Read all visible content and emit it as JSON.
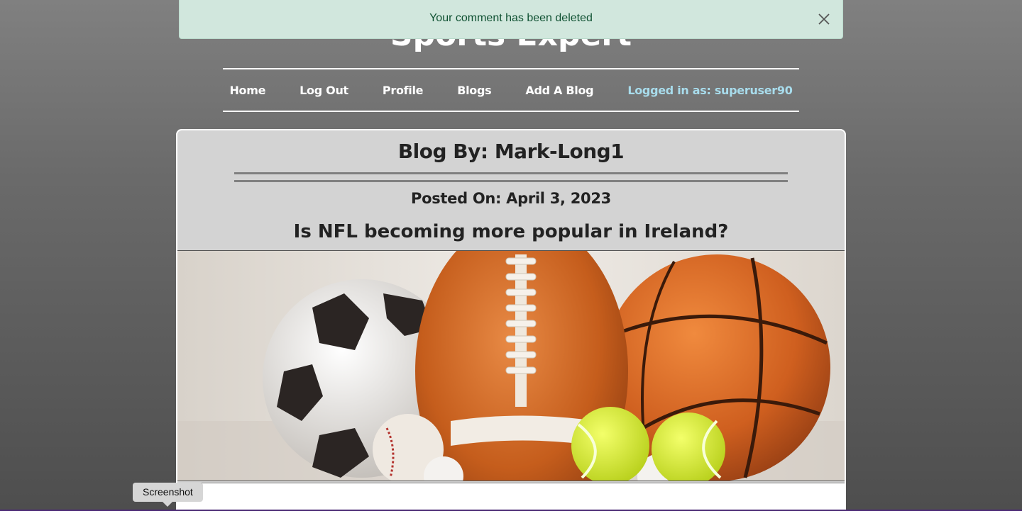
{
  "site": {
    "title": "Sports Expert"
  },
  "alert": {
    "message": "Your comment has been deleted"
  },
  "nav": {
    "items": [
      {
        "label": "Home"
      },
      {
        "label": "Log Out"
      },
      {
        "label": "Profile"
      },
      {
        "label": "Blogs"
      },
      {
        "label": "Add A Blog"
      }
    ],
    "user_status": "Logged in as: superuser90"
  },
  "post": {
    "author_line": "Blog By: Mark-Long1",
    "posted_line": "Posted On: April 3, 2023",
    "title": "Is NFL becoming more popular in Ireland?"
  },
  "tooltip": {
    "label": "Screenshot"
  },
  "colors": {
    "alert_bg": "#d1e7dd",
    "alert_text": "#0f5132",
    "nav_user": "#a8dcec",
    "card_bg": "#d3d3d3"
  },
  "icons": {
    "alert_close": "close-icon"
  }
}
